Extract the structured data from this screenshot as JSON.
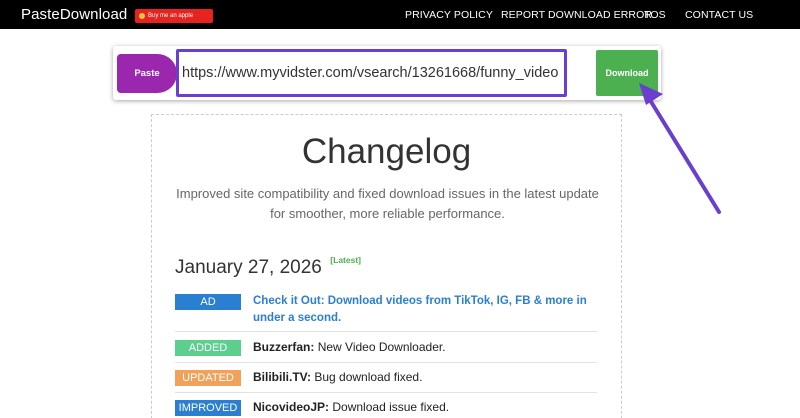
{
  "navbar": {
    "brand": "PasteDownload",
    "donate_label": "Buy me an apple",
    "links": [
      "PRIVACY POLICY",
      "REPORT DOWNLOAD ERROR",
      "TOS",
      "CONTACT US"
    ]
  },
  "url_bar": {
    "paste_label": "Paste",
    "url_value": "https://www.myvidster.com/vsearch/13261668/funny_video",
    "download_label": "Download"
  },
  "changelog": {
    "title": "Changelog",
    "subtitle": "Improved site compatibility and fixed download issues in the latest update for smoother, more reliable performance.",
    "date": "January 27, 2026",
    "latest_badge": "[Latest]",
    "entries": [
      {
        "tag": "AD",
        "tag_color": "#2b7fd0",
        "text": "Check it Out: Download videos from TikTok, IG, FB & more in under a second."
      },
      {
        "tag": "ADDED",
        "tag_color": "#5ccf8e",
        "site": "Buzzerfan:",
        "text": "New Video Downloader."
      },
      {
        "tag": "UPDATED",
        "tag_color": "#f0a15a",
        "site": "Bilibili.TV:",
        "text": "Bug download fixed."
      },
      {
        "tag": "IMPROVED",
        "tag_color": "#2b7fd0",
        "site": "NicovideoJP:",
        "text": "Download issue fixed."
      }
    ]
  },
  "colors": {
    "navbar_bg": "#000000",
    "paste_button": "#9b27af",
    "download_button": "#4caf50",
    "input_border": "#6a3fd0",
    "annotation_arrow": "#6a3fd0",
    "donate_button": "#e6231f"
  },
  "icons": {
    "donate": "apple-coin-icon",
    "annotation": "arrow-pointer-icon"
  }
}
